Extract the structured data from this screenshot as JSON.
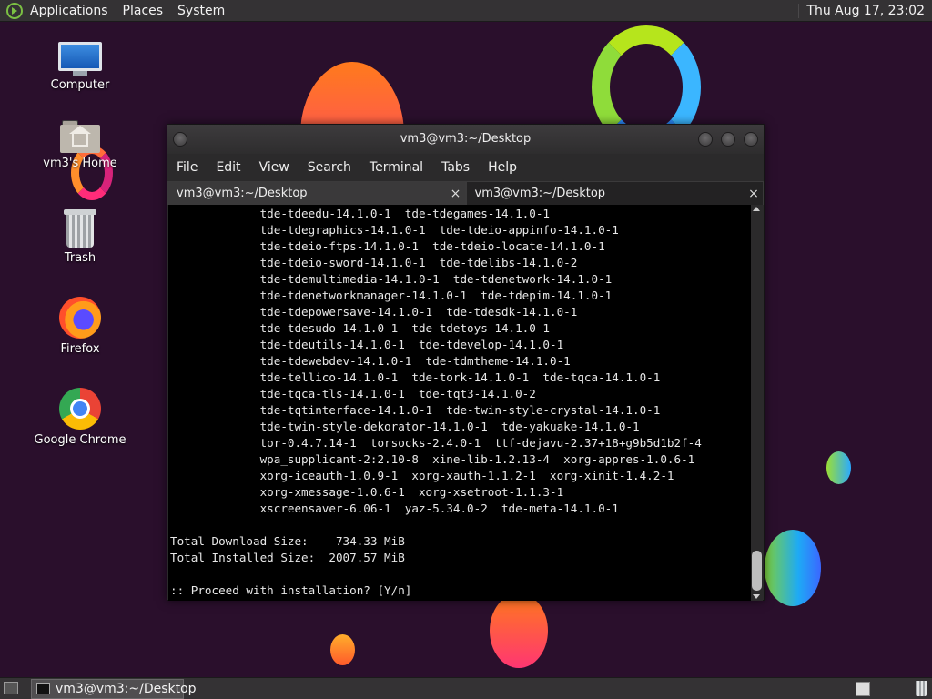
{
  "top_panel": {
    "menus": [
      "Applications",
      "Places",
      "System"
    ],
    "clock": "Thu Aug 17, 23:02"
  },
  "desktop_icons": [
    {
      "label": "Computer",
      "icon": "computer-icon"
    },
    {
      "label": "vm3's Home",
      "icon": "home-folder-icon"
    },
    {
      "label": "Trash",
      "icon": "trash-icon"
    },
    {
      "label": "Firefox",
      "icon": "firefox-icon"
    },
    {
      "label": "Google Chrome",
      "icon": "chrome-icon"
    }
  ],
  "window": {
    "title": "vm3@vm3:~/Desktop",
    "menu": [
      "File",
      "Edit",
      "View",
      "Search",
      "Terminal",
      "Tabs",
      "Help"
    ],
    "tabs": [
      {
        "label": "vm3@vm3:~/Desktop",
        "close": "×"
      },
      {
        "label": "vm3@vm3:~/Desktop",
        "close": "×"
      }
    ]
  },
  "terminal": {
    "lines": [
      "             tde-tdeedu-14.1.0-1  tde-tdegames-14.1.0-1",
      "             tde-tdegraphics-14.1.0-1  tde-tdeio-appinfo-14.1.0-1",
      "             tde-tdeio-ftps-14.1.0-1  tde-tdeio-locate-14.1.0-1",
      "             tde-tdeio-sword-14.1.0-1  tde-tdelibs-14.1.0-2",
      "             tde-tdemultimedia-14.1.0-1  tde-tdenetwork-14.1.0-1",
      "             tde-tdenetworkmanager-14.1.0-1  tde-tdepim-14.1.0-1",
      "             tde-tdepowersave-14.1.0-1  tde-tdesdk-14.1.0-1",
      "             tde-tdesudo-14.1.0-1  tde-tdetoys-14.1.0-1",
      "             tde-tdeutils-14.1.0-1  tde-tdevelop-14.1.0-1",
      "             tde-tdewebdev-14.1.0-1  tde-tdmtheme-14.1.0-1",
      "             tde-tellico-14.1.0-1  tde-tork-14.1.0-1  tde-tqca-14.1.0-1",
      "             tde-tqca-tls-14.1.0-1  tde-tqt3-14.1.0-2",
      "             tde-tqtinterface-14.1.0-1  tde-twin-style-crystal-14.1.0-1",
      "             tde-twin-style-dekorator-14.1.0-1  tde-yakuake-14.1.0-1",
      "             tor-0.4.7.14-1  torsocks-2.4.0-1  ttf-dejavu-2.37+18+g9b5d1b2f-4",
      "             wpa_supplicant-2:2.10-8  xine-lib-1.2.13-4  xorg-appres-1.0.6-1",
      "             xorg-iceauth-1.0.9-1  xorg-xauth-1.1.2-1  xorg-xinit-1.4.2-1",
      "             xorg-xmessage-1.0.6-1  xorg-xsetroot-1.1.3-1",
      "             xscreensaver-6.06-1  yaz-5.34.0-2  tde-meta-14.1.0-1",
      "",
      "Total Download Size:    734.33 MiB",
      "Total Installed Size:  2007.57 MiB",
      "",
      ":: Proceed with installation? [Y/n]"
    ]
  },
  "bottom_panel": {
    "task_label": "vm3@vm3:~/Desktop"
  }
}
